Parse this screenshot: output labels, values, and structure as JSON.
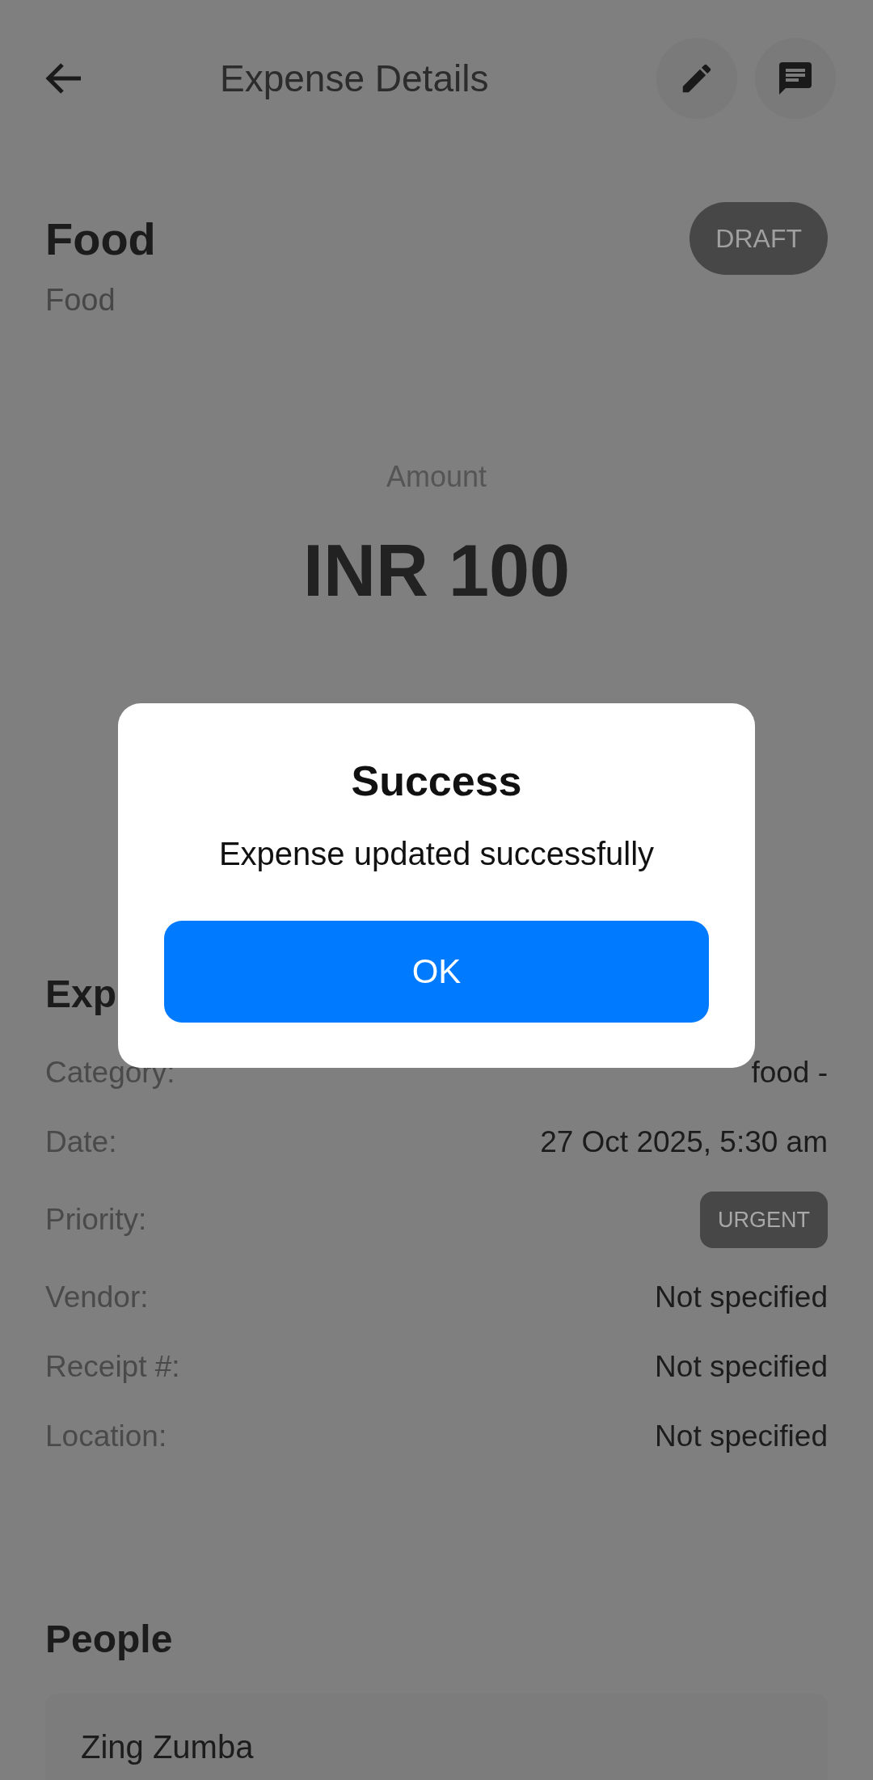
{
  "header": {
    "title": "Expense Details"
  },
  "expense": {
    "title": "Food",
    "status": "DRAFT",
    "subtitle": "Food",
    "amount_label": "Amount",
    "amount": "INR 100"
  },
  "details": {
    "heading": "Exp",
    "rows": [
      {
        "label": "Category:",
        "kind": "text",
        "value": "food -"
      },
      {
        "label": "Date:",
        "kind": "text",
        "value": "27 Oct 2025, 5:30 am"
      },
      {
        "label": "Priority:",
        "kind": "badge",
        "value": "URGENT"
      },
      {
        "label": "Vendor:",
        "kind": "text",
        "value": "Not specified"
      },
      {
        "label": "Receipt #:",
        "kind": "text",
        "value": "Not specified"
      },
      {
        "label": "Location:",
        "kind": "text",
        "value": "Not specified"
      }
    ]
  },
  "people": {
    "heading": "People",
    "items": [
      {
        "name": "Zing Zumba"
      }
    ]
  },
  "dialog": {
    "title": "Success",
    "message": "Expense updated successfully",
    "button": "OK"
  }
}
